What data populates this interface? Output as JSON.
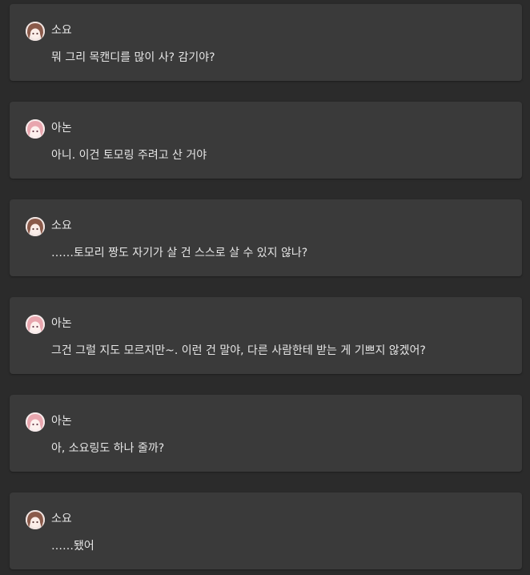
{
  "messages": [
    {
      "speaker": "소요",
      "text": "뭐 그리 목캔디를 많이 사? 감기야?"
    },
    {
      "speaker": "아논",
      "text": "아니. 이건 토모링 주려고 산 거야"
    },
    {
      "speaker": "소요",
      "text": "……토모리 짱도 자기가 살 건 스스로 살 수 있지 않나?"
    },
    {
      "speaker": "아논",
      "text": "그건 그럴 지도 모르지만~. 이런 건 말야, 다른 사람한테 받는 게 기쁘지 않겠어?"
    },
    {
      "speaker": "아논",
      "text": "아, 소요링도 하나 줄까?"
    },
    {
      "speaker": "소요",
      "text": "……됐어"
    }
  ],
  "avatar_icon": "character-portrait-icon",
  "colors": {
    "background": "#2b2b2b",
    "card": "#3a3a3a",
    "text": "#e6e6e6",
    "avatar_hair_soyo": "#8a5a4a",
    "avatar_hair_anon": "#e8a6ae"
  }
}
